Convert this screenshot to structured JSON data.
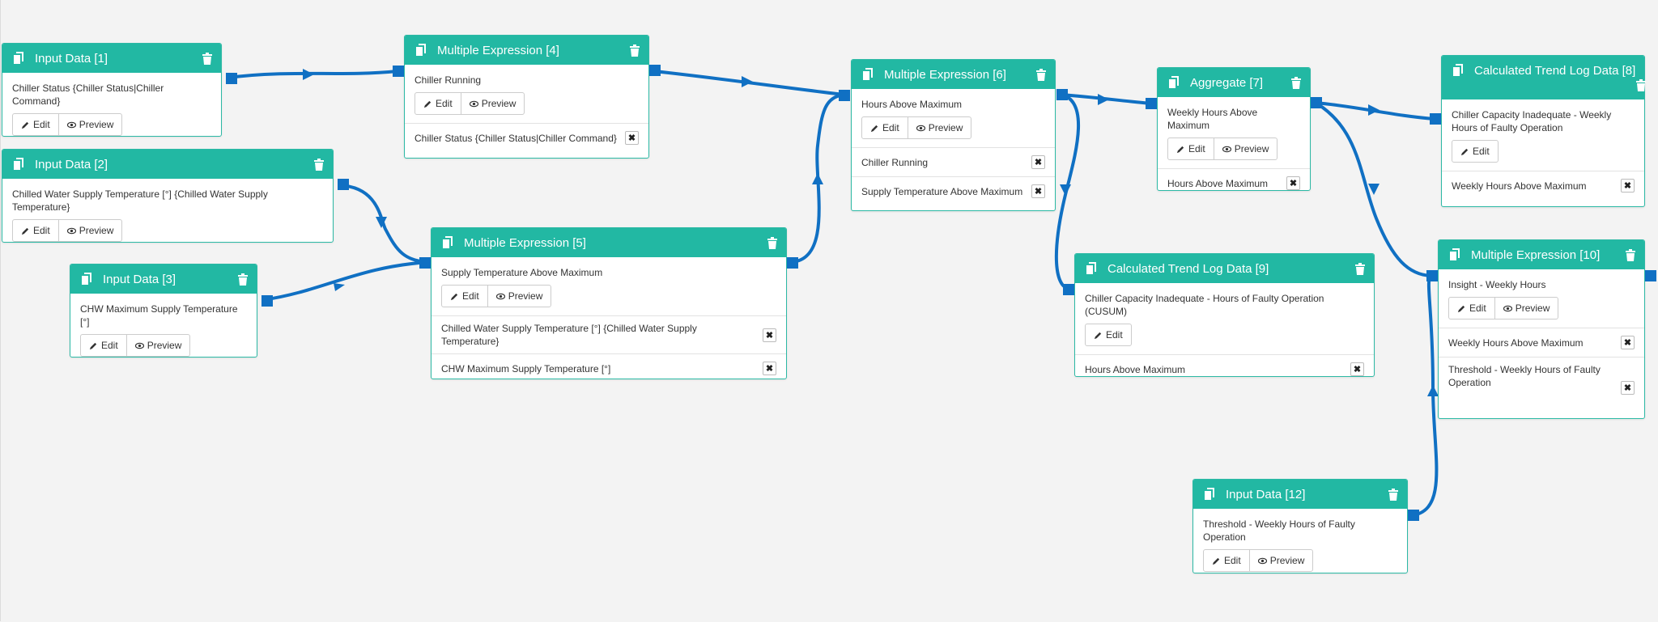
{
  "nodes": {
    "n1": {
      "title": "Input Data [1]",
      "label": "Chiller Status {Chiller Status|Chiller Command}",
      "edit": "Edit",
      "preview": "Preview"
    },
    "n2": {
      "title": "Input Data [2]",
      "label": "Chilled Water Supply Temperature [°] {Chilled Water Supply Temperature}",
      "edit": "Edit",
      "preview": "Preview"
    },
    "n3": {
      "title": "Input Data [3]",
      "label": "CHW Maximum Supply Temperature [°]",
      "edit": "Edit",
      "preview": "Preview"
    },
    "n4": {
      "title": "Multiple Expression [4]",
      "label": "Chiller Running",
      "edit": "Edit",
      "preview": "Preview",
      "inputs": [
        "Chiller Status {Chiller Status|Chiller Command}"
      ]
    },
    "n5": {
      "title": "Multiple Expression [5]",
      "label": "Supply Temperature Above Maximum",
      "edit": "Edit",
      "preview": "Preview",
      "inputs": [
        "Chilled Water Supply Temperature [°] {Chilled Water Supply Temperature}",
        "CHW Maximum Supply Temperature [°]"
      ]
    },
    "n6": {
      "title": "Multiple Expression [6]",
      "label": "Hours Above Maximum",
      "edit": "Edit",
      "preview": "Preview",
      "inputs": [
        "Chiller Running",
        "Supply Temperature Above Maximum"
      ]
    },
    "n7": {
      "title": "Aggregate [7]",
      "label": "Weekly Hours Above Maximum",
      "edit": "Edit",
      "preview": "Preview",
      "inputs": [
        "Hours Above Maximum"
      ]
    },
    "n8": {
      "title": "Calculated Trend Log Data [8]",
      "label": "Chiller Capacity Inadequate - Weekly Hours of Faulty Operation",
      "edit": "Edit",
      "inputs": [
        "Weekly Hours Above Maximum"
      ]
    },
    "n9": {
      "title": "Calculated Trend Log Data [9]",
      "label": "Chiller Capacity Inadequate - Hours of Faulty Operation (CUSUM)",
      "edit": "Edit",
      "inputs": [
        "Hours Above Maximum"
      ]
    },
    "n10": {
      "title": "Multiple Expression [10]",
      "label": "Insight - Weekly Hours",
      "edit": "Edit",
      "preview": "Preview",
      "inputs": [
        "Weekly Hours Above Maximum",
        "Threshold - Weekly Hours of Faulty Operation"
      ]
    },
    "n12": {
      "title": "Input Data [12]",
      "label": "Threshold - Weekly Hours of Faulty Operation",
      "edit": "Edit",
      "preview": "Preview"
    }
  },
  "colors": {
    "header": "#22b8a3",
    "wire": "#1070c3",
    "port": "#1070c3",
    "canvas": "#f3f3f3"
  }
}
